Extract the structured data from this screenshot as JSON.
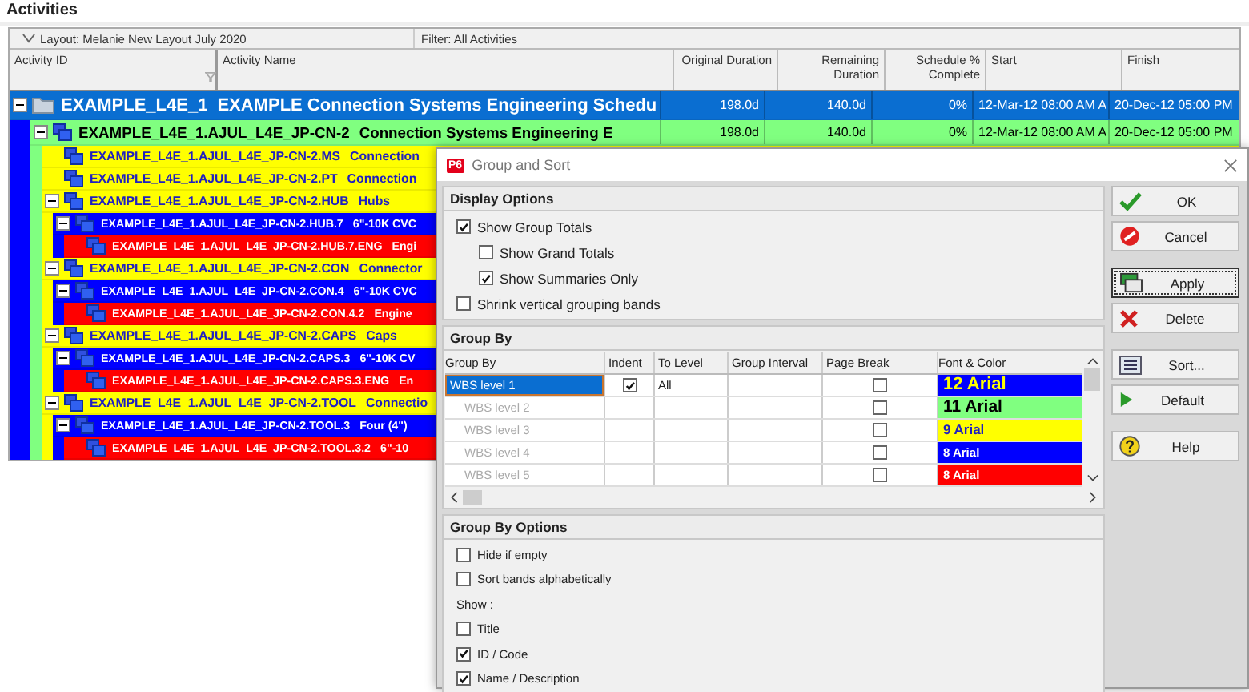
{
  "panel_title": "Activities",
  "layout_bar": {
    "layout": "Layout: Melanie New Layout July 2020",
    "filter": "Filter: All Activities"
  },
  "columns": [
    "Activity ID",
    "Activity Name",
    "Original Duration",
    "Remaining Duration",
    "Schedule % Complete",
    "Start",
    "Finish"
  ],
  "wbs_tree": [
    {
      "id": "EXAMPLE_L4E_1",
      "name": "EXAMPLE Connection Systems Engineering Schedu",
      "selected": true,
      "expanded": true,
      "values": [
        "198.0d",
        "140.0d",
        "0%",
        "12-Mar-12 08:00 AM A",
        "20-Dec-12 05:00 PM"
      ],
      "children": [
        {
          "id": "EXAMPLE_L4E_1.AJUL_L4E_JP-CN-2",
          "name": "Connection Systems Engineering E",
          "selected": false,
          "expanded": true,
          "values": [
            "198.0d",
            "140.0d",
            "0%",
            "12-Mar-12 08:00 AM A",
            "20-Dec-12 05:00 PM"
          ],
          "children": [
            {
              "id": "EXAMPLE_L4E_1.AJUL_L4E_JP-CN-2.MS",
              "name": "Connection",
              "selected": false
            },
            {
              "id": "EXAMPLE_L4E_1.AJUL_L4E_JP-CN-2.PT",
              "name": "Connection",
              "selected": false
            },
            {
              "id": "EXAMPLE_L4E_1.AJUL_L4E_JP-CN-2.HUB",
              "name": "Hubs",
              "selected": false,
              "expanded": true,
              "children": [
                {
                  "id": "EXAMPLE_L4E_1.AJUL_L4E_JP-CN-2.HUB.7",
                  "name": "6\"-10K CVC",
                  "selected": false,
                  "expanded": true,
                  "children": [
                    {
                      "id": "EXAMPLE_L4E_1.AJUL_L4E_JP-CN-2.HUB.7.ENG",
                      "name": "Engi",
                      "selected": false
                    }
                  ]
                }
              ]
            },
            {
              "id": "EXAMPLE_L4E_1.AJUL_L4E_JP-CN-2.CON",
              "name": "Connector",
              "selected": false,
              "expanded": true,
              "children": [
                {
                  "id": "EXAMPLE_L4E_1.AJUL_L4E_JP-CN-2.CON.4",
                  "name": "6\"-10K CVC",
                  "selected": false,
                  "expanded": true,
                  "children": [
                    {
                      "id": "EXAMPLE_L4E_1.AJUL_L4E_JP-CN-2.CON.4.2",
                      "name": "Engine",
                      "selected": false
                    }
                  ]
                }
              ]
            },
            {
              "id": "EXAMPLE_L4E_1.AJUL_L4E_JP-CN-2.CAPS",
              "name": "Caps",
              "selected": false,
              "expanded": true,
              "children": [
                {
                  "id": "EXAMPLE_L4E_1.AJUL_L4E_JP-CN-2.CAPS.3",
                  "name": "6\"-10K CV",
                  "selected": false,
                  "expanded": true,
                  "children": [
                    {
                      "id": "EXAMPLE_L4E_1.AJUL_L4E_JP-CN-2.CAPS.3.ENG",
                      "name": "En",
                      "selected": false
                    }
                  ]
                }
              ]
            },
            {
              "id": "EXAMPLE_L4E_1.AJUL_L4E_JP-CN-2.TOOL",
              "name": "Connectio",
              "selected": false,
              "expanded": true,
              "children": [
                {
                  "id": "EXAMPLE_L4E_1.AJUL_L4E_JP-CN-2.TOOL.3",
                  "name": "Four (4\")",
                  "selected": false,
                  "expanded": true,
                  "children": [
                    {
                      "id": "EXAMPLE_L4E_1.AJUL_L4E_JP-CN-2.TOOL.3.2",
                      "name": "6\"-10",
                      "selected": false
                    }
                  ]
                }
              ]
            }
          ]
        }
      ]
    }
  ],
  "dialog": {
    "logo": "P6",
    "title": "Group and Sort",
    "display_options": {
      "title": "Display Options",
      "options": [
        {
          "label": "Show Group Totals",
          "checked": true,
          "children": [
            {
              "label": "Show Grand Totals",
              "checked": false
            },
            {
              "label": "Show Summaries Only",
              "checked": true
            }
          ]
        },
        {
          "label": "Shrink vertical grouping bands",
          "checked": false
        }
      ]
    },
    "group_by": {
      "title": "Group By",
      "columns": [
        "Group By",
        "Indent",
        "To Level",
        "Group Interval",
        "Page Break",
        "Font & Color"
      ],
      "rows": [
        {
          "label": "WBS level 1",
          "selected": true,
          "disabled": false,
          "indent": true,
          "to_level": "All",
          "page_break": false,
          "font": {
            "label": "12 Arial",
            "color": "#ffff00"
          },
          "color": "#0000ff"
        },
        {
          "label": "WBS level 2",
          "selected": false,
          "disabled": true,
          "page_break": false,
          "font": {
            "label": "11 Arial",
            "color": "#000000"
          },
          "color": "#80ff80"
        },
        {
          "label": "WBS level 3",
          "selected": false,
          "disabled": true,
          "page_break": false,
          "font": {
            "label": "9 Arial",
            "color": "#2020c0"
          },
          "color": "#ffff00"
        },
        {
          "label": "WBS level 4",
          "selected": false,
          "disabled": true,
          "page_break": false,
          "font": {
            "label": "8 Arial",
            "color": "#ffffff"
          },
          "color": "#0000ff"
        },
        {
          "label": "WBS level 5",
          "selected": false,
          "disabled": true,
          "page_break": false,
          "font": {
            "label": "8 Arial",
            "color": "#ffffff"
          },
          "color": "#ff0000"
        }
      ]
    },
    "group_by_options": {
      "title": "Group By Options",
      "options": [
        {
          "kind": "checkbox",
          "label": "Hide if empty",
          "checked": false
        },
        {
          "kind": "checkbox",
          "label": "Sort bands alphabetically",
          "checked": false
        },
        {
          "kind": "label",
          "label": "Show :"
        },
        {
          "kind": "checkbox",
          "label": "Title",
          "checked": false
        },
        {
          "kind": "checkbox",
          "label": "ID / Code",
          "checked": true
        },
        {
          "kind": "checkbox",
          "label": "Name / Description",
          "checked": true
        }
      ]
    },
    "button_groups": [
      {
        "buttons": [
          {
            "label": "OK",
            "kind": "check",
            "focused": false
          },
          {
            "label": "Cancel",
            "kind": "cancel",
            "focused": false
          }
        ]
      },
      {
        "buttons": [
          {
            "label": "Apply",
            "kind": "apply",
            "focused": true
          },
          {
            "label": "Delete",
            "kind": "delete",
            "focused": false
          }
        ]
      },
      {
        "buttons": [
          {
            "label": "Sort...",
            "kind": "sort",
            "focused": false
          },
          {
            "label": "Default",
            "kind": "default",
            "focused": false
          }
        ]
      },
      {
        "buttons": [
          {
            "label": "Help",
            "kind": "help",
            "focused": false
          }
        ]
      }
    ]
  }
}
